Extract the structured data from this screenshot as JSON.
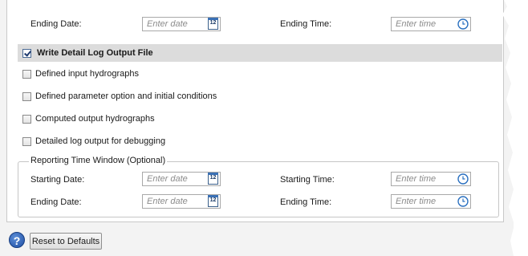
{
  "top_range": {
    "ending_date_label": "Ending Date:",
    "ending_date_placeholder": "Enter date",
    "ending_time_label": "Ending Time:",
    "ending_time_placeholder": "Enter time"
  },
  "detail_log": {
    "label": "Write Detail Log Output File",
    "checked": true
  },
  "options": [
    {
      "label": "Defined input hydrographs",
      "checked": false
    },
    {
      "label": "Defined parameter option and initial conditions",
      "checked": false
    },
    {
      "label": "Computed output hydrographs",
      "checked": false
    },
    {
      "label": "Detailed log output for debugging",
      "checked": false
    }
  ],
  "reporting_window": {
    "title": "Reporting Time Window (Optional)",
    "starting_date_label": "Starting Date:",
    "starting_date_placeholder": "Enter date",
    "starting_time_label": "Starting Time:",
    "starting_time_placeholder": "Enter time",
    "ending_date_label": "Ending Date:",
    "ending_date_placeholder": "Enter date",
    "ending_time_label": "Ending Time:",
    "ending_time_placeholder": "Enter time"
  },
  "calendar_icon_text": "12",
  "help_icon_text": "?",
  "footer": {
    "reset_label": "Reset to Defaults"
  }
}
